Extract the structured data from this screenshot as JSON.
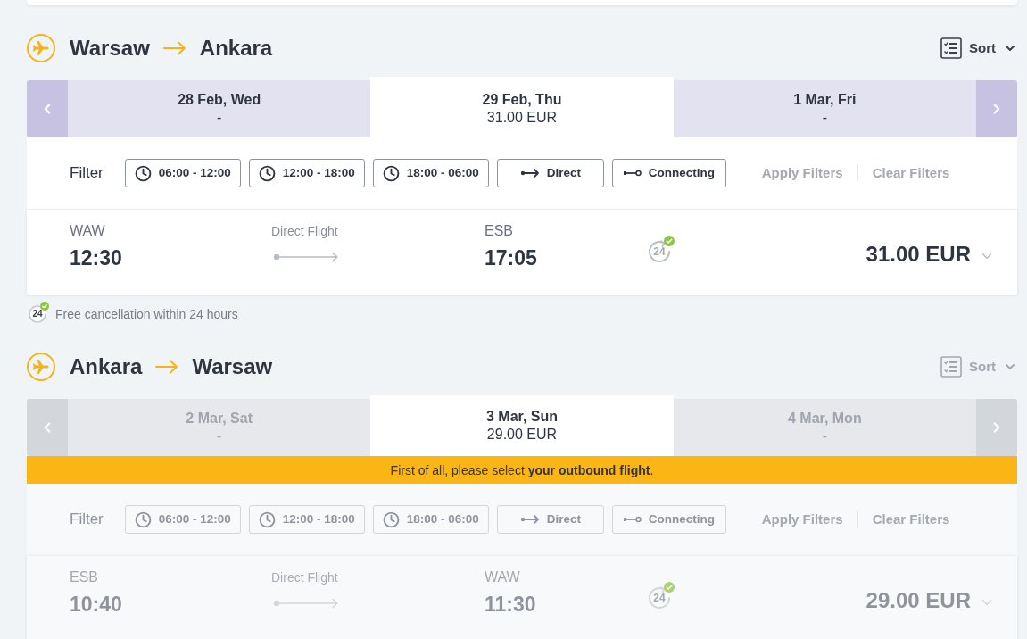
{
  "legs": [
    {
      "from": "Warsaw",
      "to": "Ankara",
      "disabled": false,
      "sort": "Sort",
      "dates": [
        {
          "date": "28 Feb, Wed",
          "price": "-",
          "selected": false
        },
        {
          "date": "29 Feb, Thu",
          "price": "31.00 EUR",
          "selected": true
        },
        {
          "date": "1 Mar, Fri",
          "price": "-",
          "selected": false
        }
      ],
      "filter": {
        "label": "Filter",
        "options": [
          {
            "kind": "time",
            "label": "06:00 - 12:00"
          },
          {
            "kind": "time",
            "label": "12:00 - 18:00"
          },
          {
            "kind": "time",
            "label": "18:00 - 06:00"
          },
          {
            "kind": "direct",
            "label": "Direct"
          },
          {
            "kind": "connecting",
            "label": "Connecting"
          }
        ],
        "actions": [
          {
            "label": "Apply Filters",
            "disabled": true
          },
          {
            "label": "Clear Filters",
            "disabled": true
          }
        ]
      },
      "flights": [
        {
          "origin": "WAW",
          "departure": "12:30",
          "route": "Direct Flight",
          "destination": "ESB",
          "arrival": "17:05",
          "cancellation_badge": "24",
          "price": "31.00 EUR"
        }
      ],
      "note": {
        "badge": "24",
        "text": "Free cancellation within 24 hours"
      }
    },
    {
      "from": "Ankara",
      "to": "Warsaw",
      "disabled": true,
      "sort": "Sort",
      "dates": [
        {
          "date": "2 Mar, Sat",
          "price": "-",
          "selected": false
        },
        {
          "date": "3 Mar, Sun",
          "price": "29.00 EUR",
          "selected": true
        },
        {
          "date": "4 Mar, Mon",
          "price": "-",
          "selected": false
        }
      ],
      "notice": "First of all, please select **your outbound flight**.",
      "filter": {
        "label": "Filter",
        "options": [
          {
            "kind": "time",
            "label": "06:00 - 12:00"
          },
          {
            "kind": "time",
            "label": "12:00 - 18:00"
          },
          {
            "kind": "time",
            "label": "18:00 - 06:00"
          },
          {
            "kind": "direct",
            "label": "Direct"
          },
          {
            "kind": "connecting",
            "label": "Connecting"
          }
        ],
        "actions": [
          {
            "label": "Apply Filters",
            "disabled": true
          },
          {
            "label": "Clear Filters",
            "disabled": true
          }
        ]
      },
      "flights": [
        {
          "origin": "ESB",
          "departure": "10:40",
          "route": "Direct Flight",
          "destination": "WAW",
          "arrival": "11:30",
          "cancellation_badge": "24",
          "price": "29.00 EUR"
        }
      ]
    }
  ]
}
